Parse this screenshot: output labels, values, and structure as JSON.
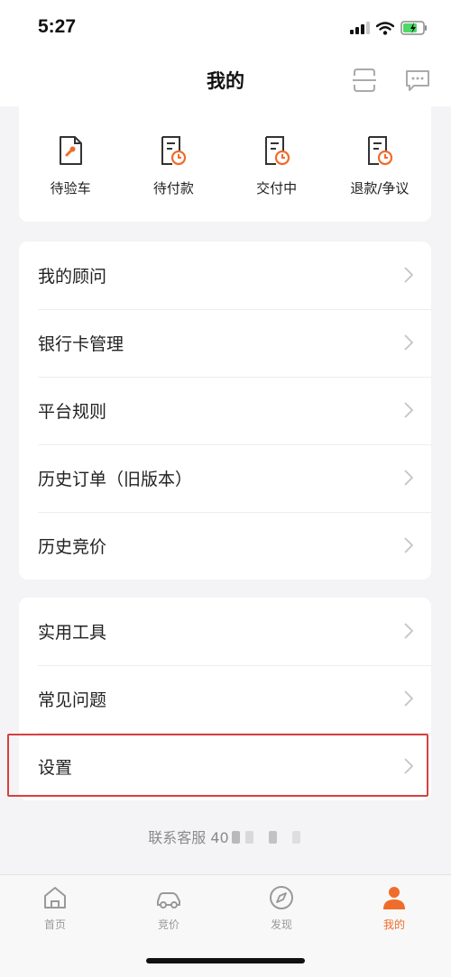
{
  "status_bar": {
    "time": "5:27"
  },
  "nav": {
    "title": "我的"
  },
  "orders": [
    {
      "label": "待验车",
      "icon": "wrench-document-icon"
    },
    {
      "label": "待付款",
      "icon": "clock-document-icon"
    },
    {
      "label": "交付中",
      "icon": "clock-document-icon"
    },
    {
      "label": "退款/争议",
      "icon": "clock-document-icon"
    }
  ],
  "menu_group_1": [
    {
      "label": "我的顾问"
    },
    {
      "label": "银行卡管理"
    },
    {
      "label": "平台规则"
    },
    {
      "label": "历史订单（旧版本）"
    },
    {
      "label": "历史竞价"
    }
  ],
  "menu_group_2": [
    {
      "label": "实用工具"
    },
    {
      "label": "常见问题"
    },
    {
      "label": "设置"
    }
  ],
  "contact": {
    "text": "联系客服 40"
  },
  "tabs": [
    {
      "label": "首页",
      "icon": "home-icon"
    },
    {
      "label": "竞价",
      "icon": "car-icon"
    },
    {
      "label": "发现",
      "icon": "compass-icon"
    },
    {
      "label": "我的",
      "icon": "person-icon"
    }
  ],
  "colors": {
    "accent": "#ef6c2b",
    "highlight": "#d8403f",
    "background": "#f4f4f6"
  }
}
